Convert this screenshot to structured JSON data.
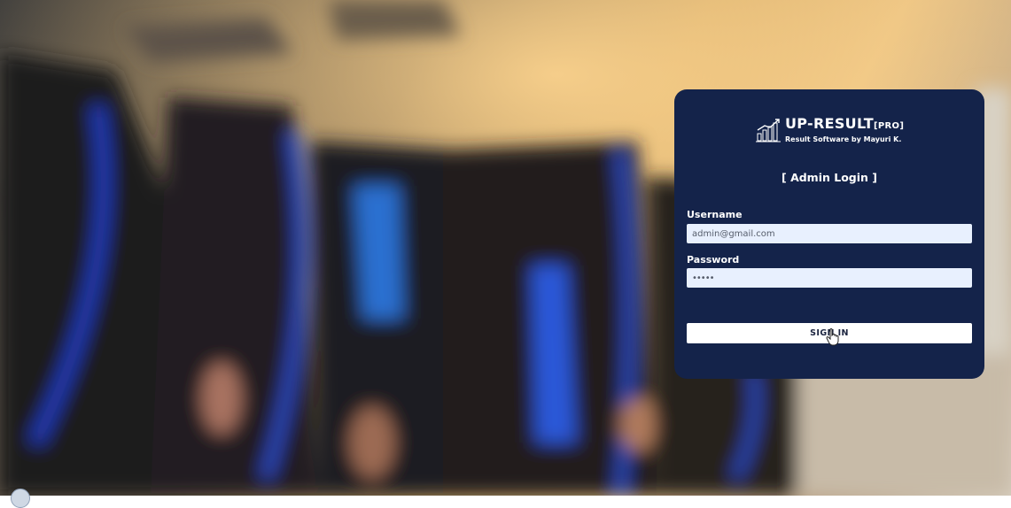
{
  "background": {
    "description_icon": "graduation-ceremony-photo"
  },
  "brand": {
    "title": "UP-RESULT",
    "title_suffix": "[PRO]",
    "subtitle": "Result Software by Mayuri K.",
    "logo_icon": "bar-chart-growth-icon"
  },
  "login": {
    "heading": "[ Admin Login ]",
    "username_label": "Username",
    "username_value": "admin@gmail.com",
    "password_label": "Password",
    "password_value": "•••••",
    "signin_label": "SIGN IN"
  },
  "colors": {
    "card_background": "#14234a",
    "input_background": "#e8f0fe",
    "button_background": "#ffffff"
  }
}
